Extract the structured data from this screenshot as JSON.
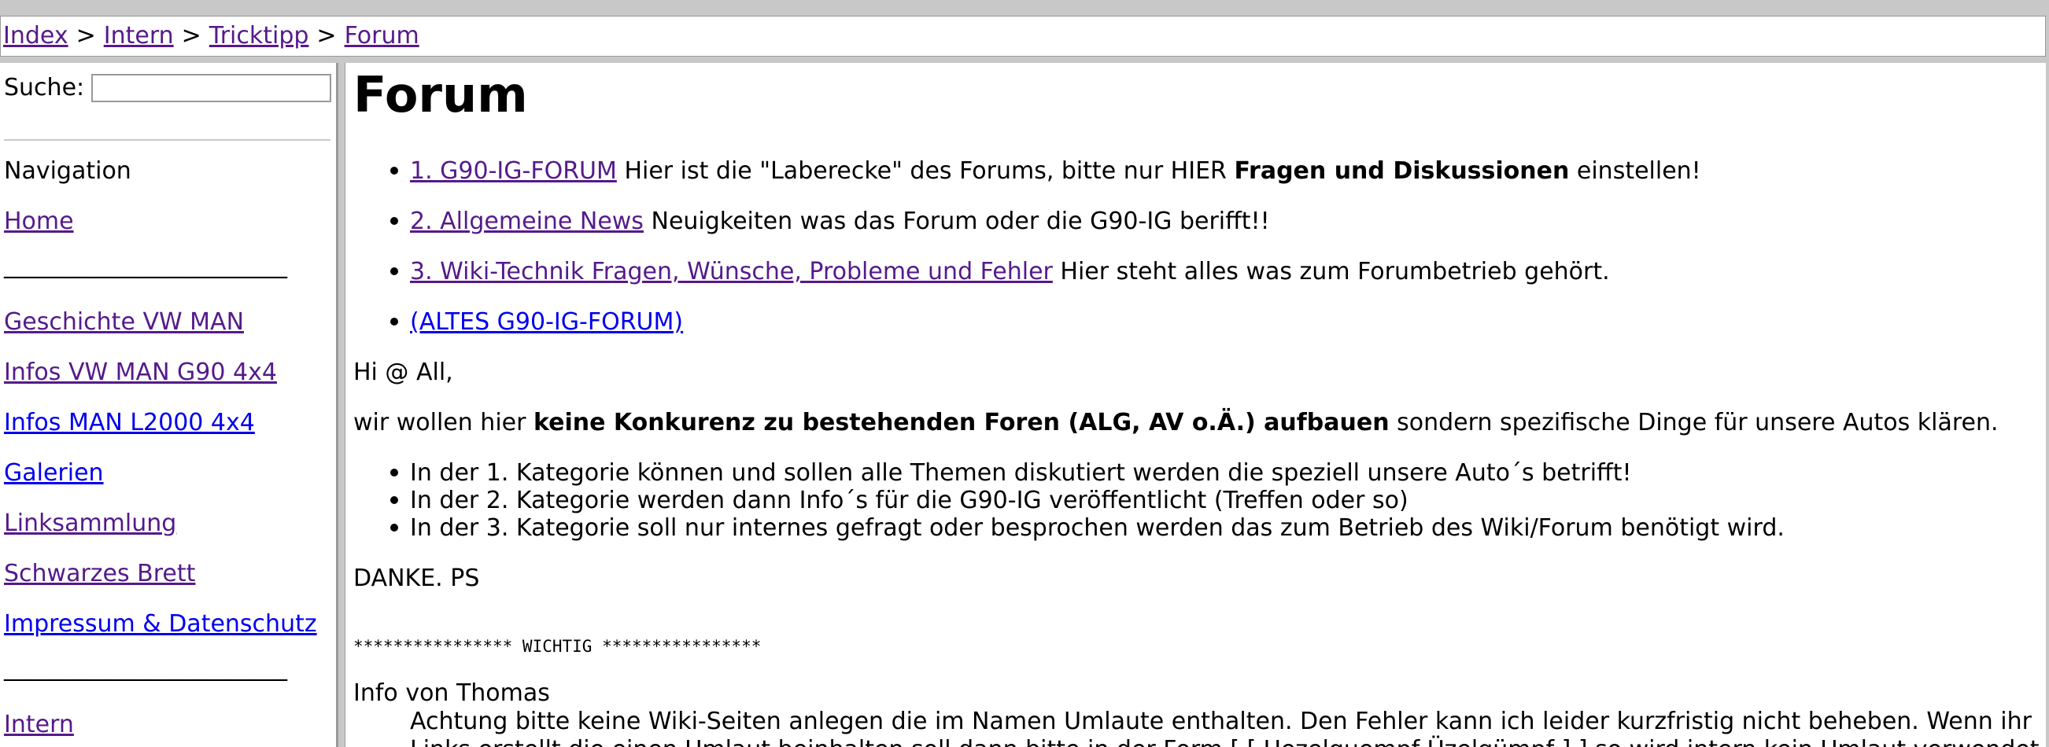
{
  "breadcrumb": {
    "items": [
      "Index",
      "Intern",
      "Tricktipp",
      "Forum"
    ],
    "separator": ">"
  },
  "sidebar": {
    "search_label": "Suche:",
    "search_value": "",
    "navigation_heading": "Navigation",
    "divider_text": "________________________",
    "links": {
      "home": "Home",
      "geschichte": "Geschichte VW MAN",
      "infos_g90": "Infos VW MAN G90 4x4",
      "infos_l2000": "Infos MAN L2000 4x4",
      "galerien": "Galerien",
      "linksammlung": "Linksammlung",
      "schwarzes_brett": "Schwarzes Brett",
      "impressum": "Impressum & Datenschutz",
      "intern": "Intern"
    }
  },
  "main": {
    "title": "Forum",
    "forum_items": [
      {
        "link": "1. G90-IG-FORUM",
        "text_before": "Hier ist die \"Laberecke\" des Forums, bitte nur HIER",
        "bold": "Fragen und Diskussionen",
        "text_after": "einstellen!"
      },
      {
        "link": "2. Allgemeine News",
        "text": "Neuigkeiten was das Forum oder die G90-IG berifft!!"
      },
      {
        "link": "3. Wiki-Technik Fragen, Wünsche, Probleme und Fehler",
        "text": "Hier steht alles was zum Forumbetrieb gehört."
      },
      {
        "link": "(ALTES G90-IG-FORUM)"
      }
    ],
    "greeting": "Hi @ All,",
    "intro_before": "wir wollen hier",
    "intro_bold": "keine Konkurenz zu bestehenden Foren (ALG, AV o.Ä.) aufbauen",
    "intro_after": "sondern spezifische Dinge für unsere Autos klären.",
    "categories": [
      "In der 1. Kategorie können und sollen alle Themen diskutiert werden die speziell unsere Auto´s betrifft!",
      "In der 2. Kategorie werden dann Info´s für die G90-IG veröffentlicht (Treffen oder so)",
      "In der 3. Kategorie soll nur internes gefragt oder besprochen werden das zum Betrieb des Wiki/Forum benötigt wird."
    ],
    "thanks": "DANKE. PS",
    "important": "**************** WICHTIG ****************",
    "info_heading": "Info von Thomas",
    "info_line1": "Achtung bitte keine Wiki-Seiten anlegen die im Namen Umlaute enthalten. Den Fehler kann ich leider kurzfristig nicht beheben. Wenn ihr",
    "info_line2": "Links erstellt die einen Umlaut beinhalten soll dann bitte in der Form [ [ Uezelguempf Üzelgümpf ] ] so wird intern kein Umlaut verwendet"
  }
}
